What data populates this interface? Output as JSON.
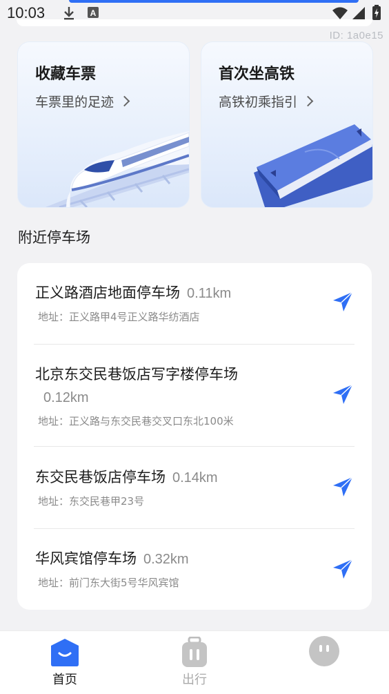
{
  "status_bar": {
    "time": "10:03"
  },
  "watermark": "ID: 1a0e15",
  "cards": [
    {
      "title": "收藏车票",
      "subtitle": "车票里的足迹"
    },
    {
      "title": "首次坐高铁",
      "subtitle": "高铁初乘指引"
    }
  ],
  "nearby": {
    "section_title": "附近停车场",
    "items": [
      {
        "name": "正义路酒店地面停车场",
        "distance": "0.11km",
        "address": "地址：正义路甲4号正义路华纺酒店"
      },
      {
        "name": "北京东交民巷饭店写字楼停车场",
        "distance": "0.12km",
        "address": "地址：正义路与东交民巷交叉口东北100米"
      },
      {
        "name": "东交民巷饭店停车场",
        "distance": "0.14km",
        "address": "地址：东交民巷甲23号"
      },
      {
        "name": "华风宾馆停车场",
        "distance": "0.32km",
        "address": "地址：前门东大街5号华风宾馆"
      }
    ]
  },
  "tabs": [
    {
      "label": "首页",
      "icon": "home-icon",
      "active": true
    },
    {
      "label": "出行",
      "icon": "luggage-icon",
      "active": false
    },
    {
      "label": "",
      "icon": "profile-face-icon",
      "active": false
    }
  ],
  "colors": {
    "accent": "#2f6ff5",
    "inactive": "#b5b5b5",
    "background": "#f2f2f4"
  }
}
